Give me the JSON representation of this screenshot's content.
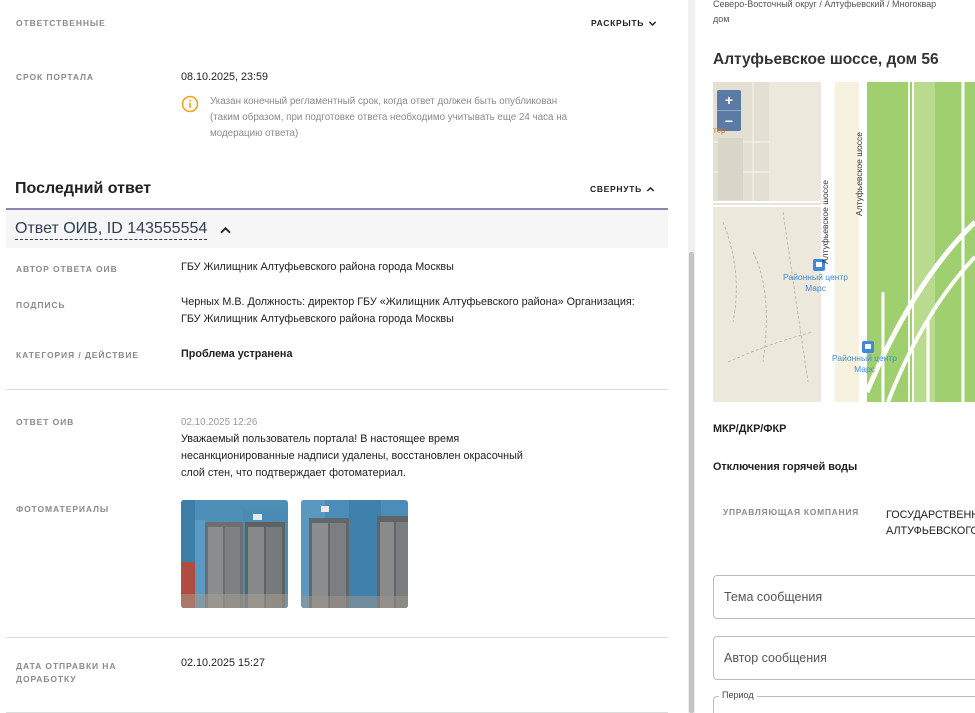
{
  "left": {
    "responsible": {
      "label": "Ответственные",
      "toggle": "Раскрыть"
    },
    "portal_deadline": {
      "label": "Срок портала",
      "value": "08.10.2025, 23:59",
      "note_line1": "Указан конечный регламентный срок, когда ответ должен быть опубликован",
      "note_line2": "(таким образом, при подготовке ответа необходимо учитывать еще 24 часа на",
      "note_line3": "модерацию ответа)"
    },
    "last_answer": {
      "title": "Последний ответ",
      "toggle": "Свернуть"
    },
    "answer": {
      "title": "Ответ ОИВ, ID 143555554",
      "author_label": "Автор ответа ОИВ",
      "author_value": "ГБУ Жилищник Алтуфьевского района города Москвы",
      "signature_label": "Подпись",
      "signature_line1": "Черных М.В. Должность: директор ГБУ «Жилищник Алтуфьевского района» Организация:",
      "signature_line2": "ГБУ Жилищник Алтуфьевского района города Москвы",
      "category_label": "Категория / действие",
      "category_value": "Проблема устранена",
      "response_label": "Ответ ОИВ",
      "response_date": "02.10.2025 12:26",
      "response_line1": "Уважаемый пользователь портала! В настоящее время",
      "response_line2": "несанкционированные надписи удалены, восстановлен окрасочный",
      "response_line3": "слой стен, что подтверждает фотоматериал.",
      "photos_label": "Фотоматериалы",
      "rework_label_line1": "Дата отправки на",
      "rework_label_line2": "доработку",
      "rework_value": "02.10.2025 15:27"
    }
  },
  "right": {
    "breadcrumb_line1": "Северо-Восточный округ / Алтуфьевский / Многоквар",
    "breadcrumb_line2": "дом",
    "address": "Алтуфьевское шоссе, дом 56",
    "map": {
      "zoom_in": "+",
      "zoom_out": "−",
      "street1": "Алтуфьевское шоссе",
      "street2": "Алтуфьевское шоссе",
      "poi1_line1": "Районный центр",
      "poi1_line2": "Марс",
      "poi2_line1": "Районный центр",
      "poi2_line2": "Марс",
      "edge_label": "тер"
    },
    "mkr_label": "МКР/ДКР/ФКР",
    "hot_water_label": "Отключения горячей воды",
    "uk_label": "Управляющая компания",
    "uk_value_line1": "ГОСУДАРСТВЕНН",
    "uk_value_line2": "АЛТУФЬЕВСКОГО",
    "subject_placeholder": "Тема сообщения",
    "author_placeholder": "Автор сообщения",
    "period_label": "Период"
  },
  "colors": {
    "accent_purple": "#8f85b5",
    "info_orange": "#f5a01a",
    "link_dark": "#2d3e55",
    "map_green": "#9fcf6e",
    "zoom_blue": "#5b7ba6",
    "poi_blue": "#3f8bd8"
  }
}
